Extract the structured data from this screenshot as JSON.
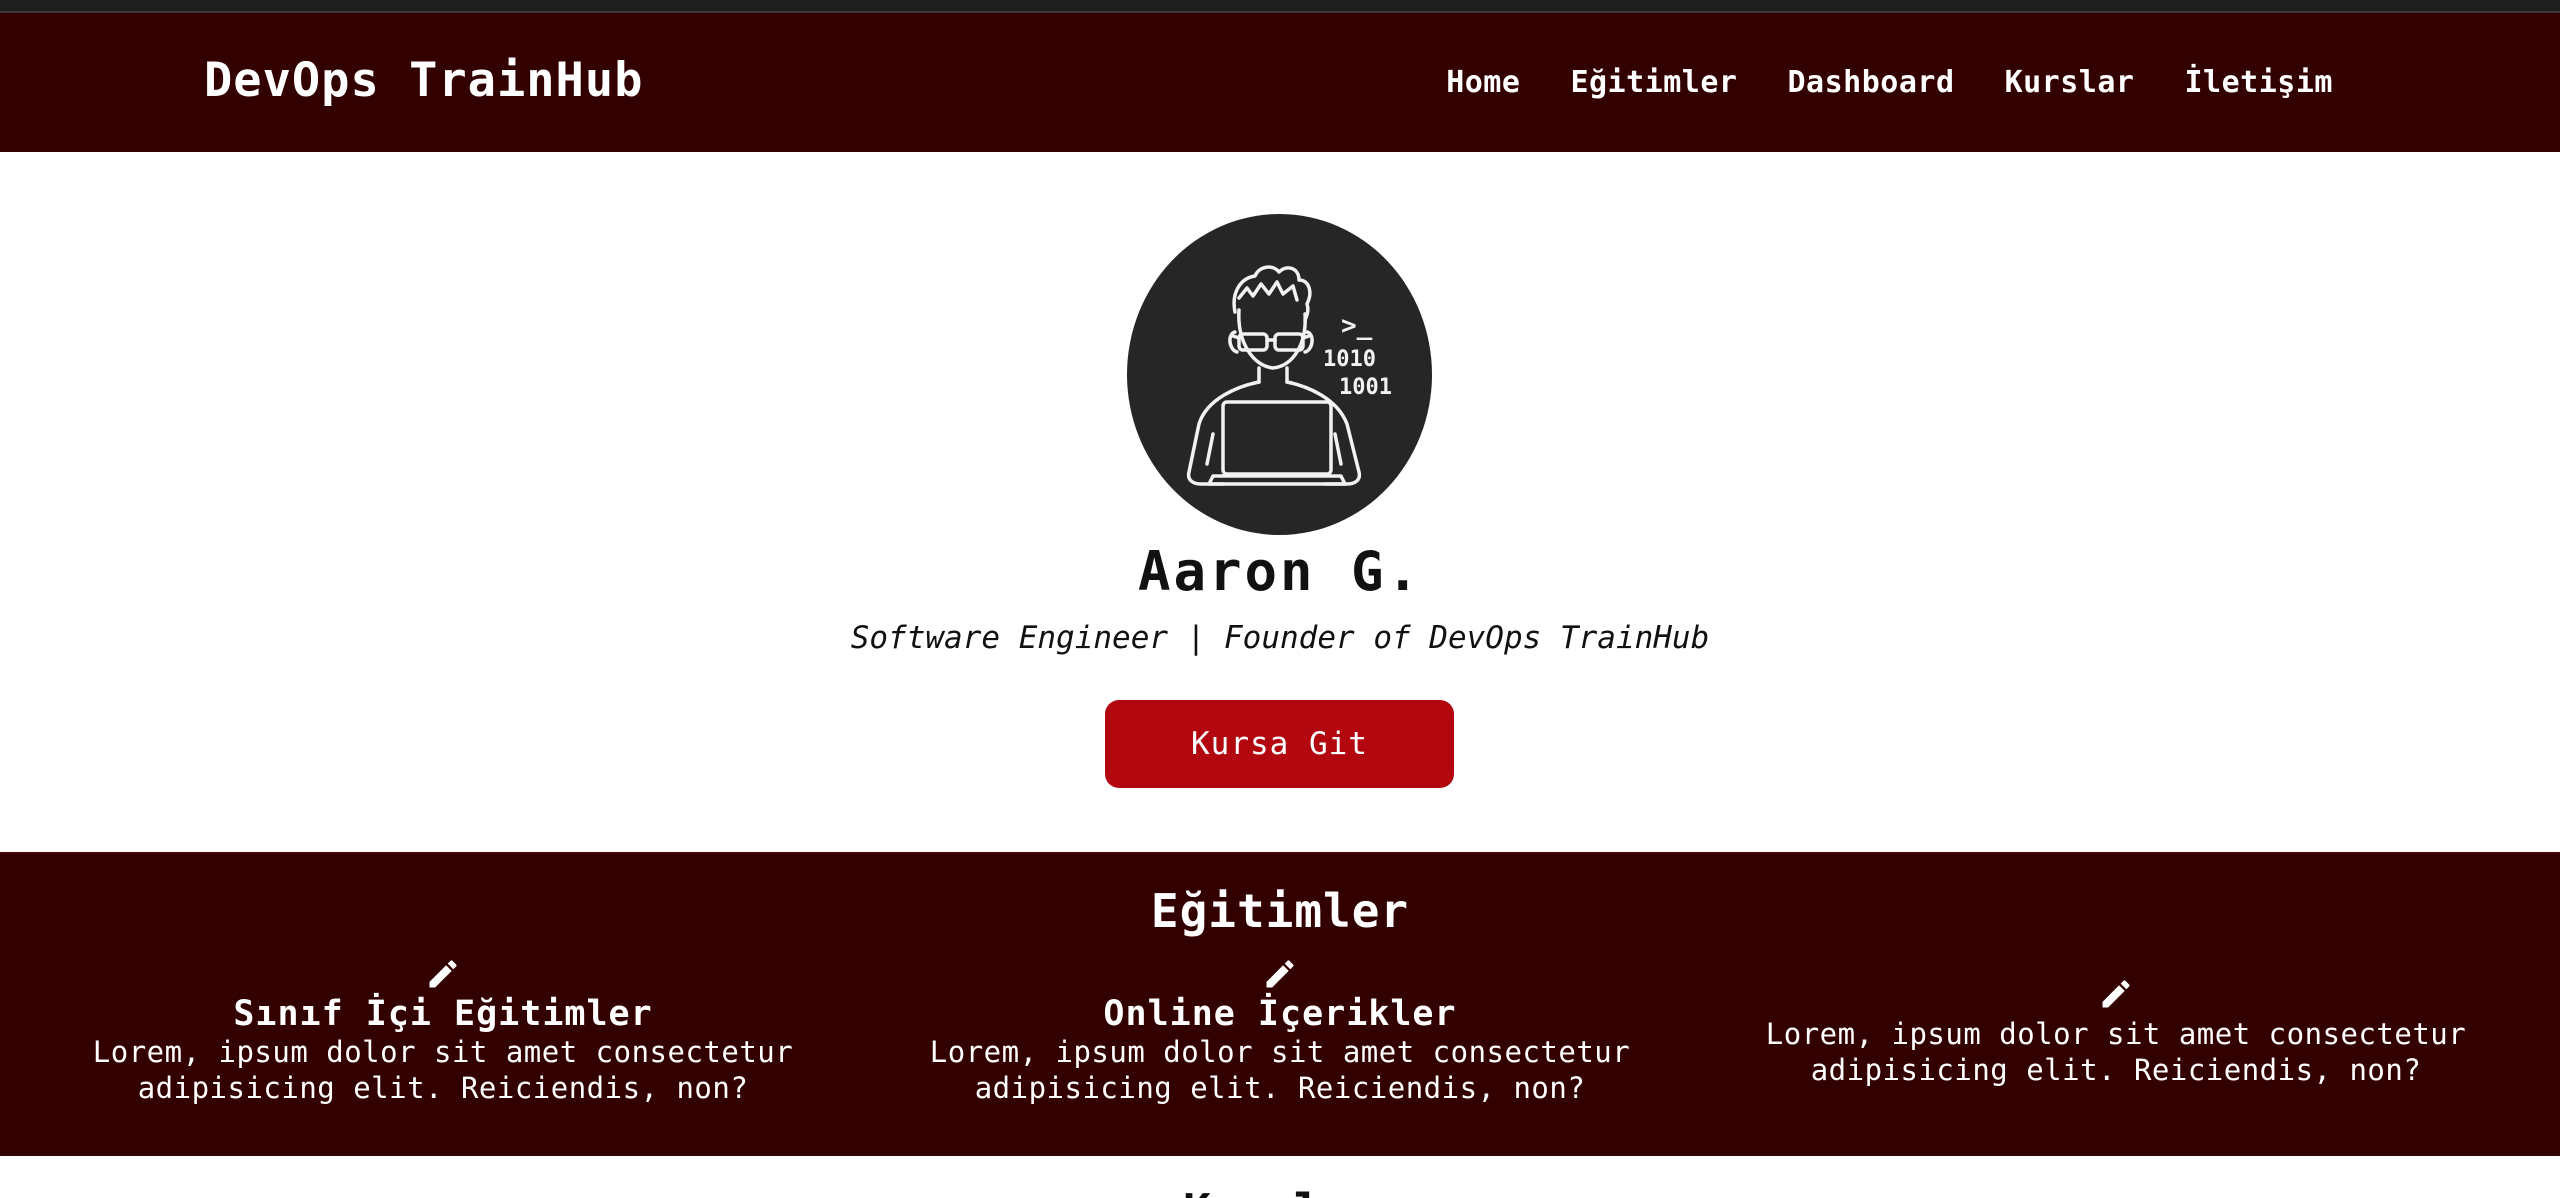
{
  "header": {
    "brand": "DevOps TrainHub",
    "nav": [
      "Home",
      "Eğitimler",
      "Dashboard",
      "Kurslar",
      "İletişim"
    ]
  },
  "hero": {
    "avatar_icon": "developer-laptop-illustration",
    "avatar_glyphs": {
      "prompt": ">_",
      "line1": "1010",
      "line2": "1001"
    },
    "name": "Aaron G.",
    "subtitle": "Software Engineer | Founder of DevOps TrainHub",
    "cta_label": "Kursa Git"
  },
  "features": {
    "title": "Eğitimler",
    "icon": "pencil-icon",
    "items": [
      {
        "title": "Sınıf İçi Eğitimler",
        "text": "Lorem, ipsum dolor sit amet consectetur adipisicing elit. Reiciendis, non?"
      },
      {
        "title": "Online İçerikler",
        "text": "Lorem, ipsum dolor sit amet consectetur adipisicing elit. Reiciendis, non?"
      },
      {
        "title": "",
        "text": "Lorem, ipsum dolor sit amet consectetur adipisicing elit. Reiciendis, non?"
      }
    ]
  },
  "next_section": {
    "title": "Kurslar"
  },
  "colors": {
    "primary_dark": "#330000",
    "accent": "#b30710",
    "avatar_bg": "#262626"
  }
}
